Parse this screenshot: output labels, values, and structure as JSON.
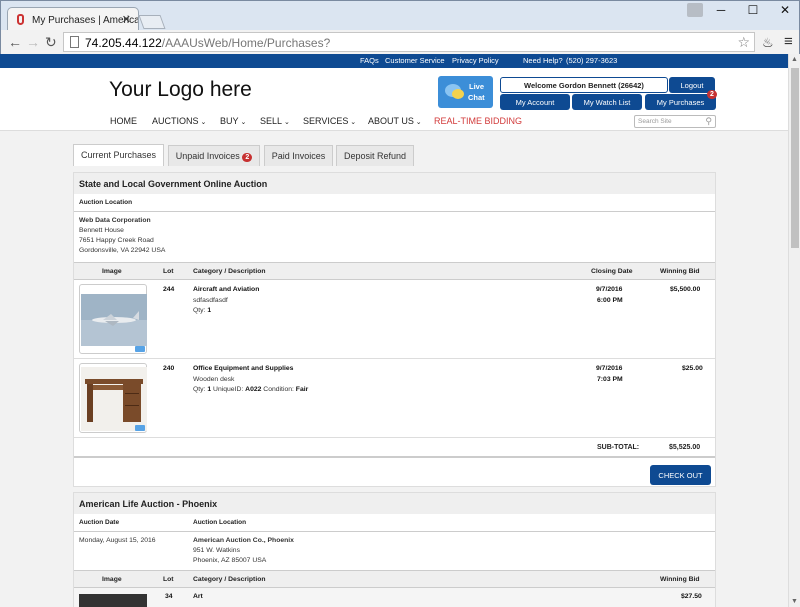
{
  "browser": {
    "tab_title": "My Purchases | American",
    "url_host": "74.205.44.122",
    "url_path": "/AAAUsWeb/Home/Purchases?"
  },
  "topbar": {
    "links": [
      "FAQs",
      "Customer Service",
      "Privacy Policy"
    ],
    "help_label": "Need Help?",
    "phone": "(520) 297-3623"
  },
  "header": {
    "logo_text": "Your Logo here",
    "livechat_line1": "Live",
    "livechat_line2": "Chat",
    "welcome": "Welcome Gordon Bennett (26642)",
    "logout": "Logout",
    "my_account": "My Account",
    "my_watch_list": "My Watch List",
    "my_purchases": "My Purchases",
    "my_purchases_badge": "2",
    "search_placeholder": "Search Site"
  },
  "nav": {
    "home": "HOME",
    "auctions": "AUCTIONS",
    "buy": "BUY",
    "sell": "SELL",
    "services": "SERVICES",
    "about": "ABOUT US",
    "realtime": "REAL-TIME BIDDING"
  },
  "tabs": {
    "current": "Current Purchases",
    "unpaid": "Unpaid Invoices",
    "unpaid_badge": "2",
    "paid": "Paid Invoices",
    "deposit": "Deposit Refund"
  },
  "auction1": {
    "title": "State and Local Government Online Auction",
    "location_header": "Auction Location",
    "loc_name": "Web Data Corporation",
    "loc_line1": "Bennett House",
    "loc_line2": "7651 Happy Creek Road",
    "loc_line3": "Gordonsville, VA 22942 USA",
    "columns": {
      "image": "Image",
      "lot": "Lot",
      "category": "Category / Description",
      "closing": "Closing Date",
      "winning": "Winning Bid"
    },
    "items": [
      {
        "lot": "244",
        "category": "Aircraft and Aviation",
        "desc": "sdfasdfasdf",
        "qty_label": "Qty:",
        "qty": "1",
        "date": "9/7/2016",
        "time": "6:00 PM",
        "bid": "$5,500.00"
      },
      {
        "lot": "240",
        "category": "Office Equipment and Supplies",
        "desc": "Wooden desk",
        "qty_label": "Qty:",
        "qty": "1",
        "unique_label": "UniqueID:",
        "unique": "A022",
        "condition_label": "Condition:",
        "condition": "Fair",
        "date": "9/7/2016",
        "time": "7:03 PM",
        "bid": "$25.00"
      }
    ],
    "subtotal_label": "SUB-TOTAL:",
    "subtotal": "$5,525.00",
    "checkout": "CHECK OUT"
  },
  "auction2": {
    "title": "American Life Auction - Phoenix",
    "date_header": "Auction Date",
    "location_header": "Auction Location",
    "date": "Monday, August 15, 2016",
    "loc_name": "American Auction Co., Phoenix",
    "loc_line1": "951 W. Watkins",
    "loc_line2": "Phoenix, AZ 85007 USA",
    "columns": {
      "image": "Image",
      "lot": "Lot",
      "category": "Category / Description",
      "winning": "Winning Bid"
    },
    "item": {
      "lot": "34",
      "category": "Art",
      "bid": "$27.50"
    }
  },
  "colors": {
    "brand": "#0e4a92",
    "badge": "#c73131",
    "realtime": "#d23a3a",
    "livechat": "#3c8ed8"
  }
}
